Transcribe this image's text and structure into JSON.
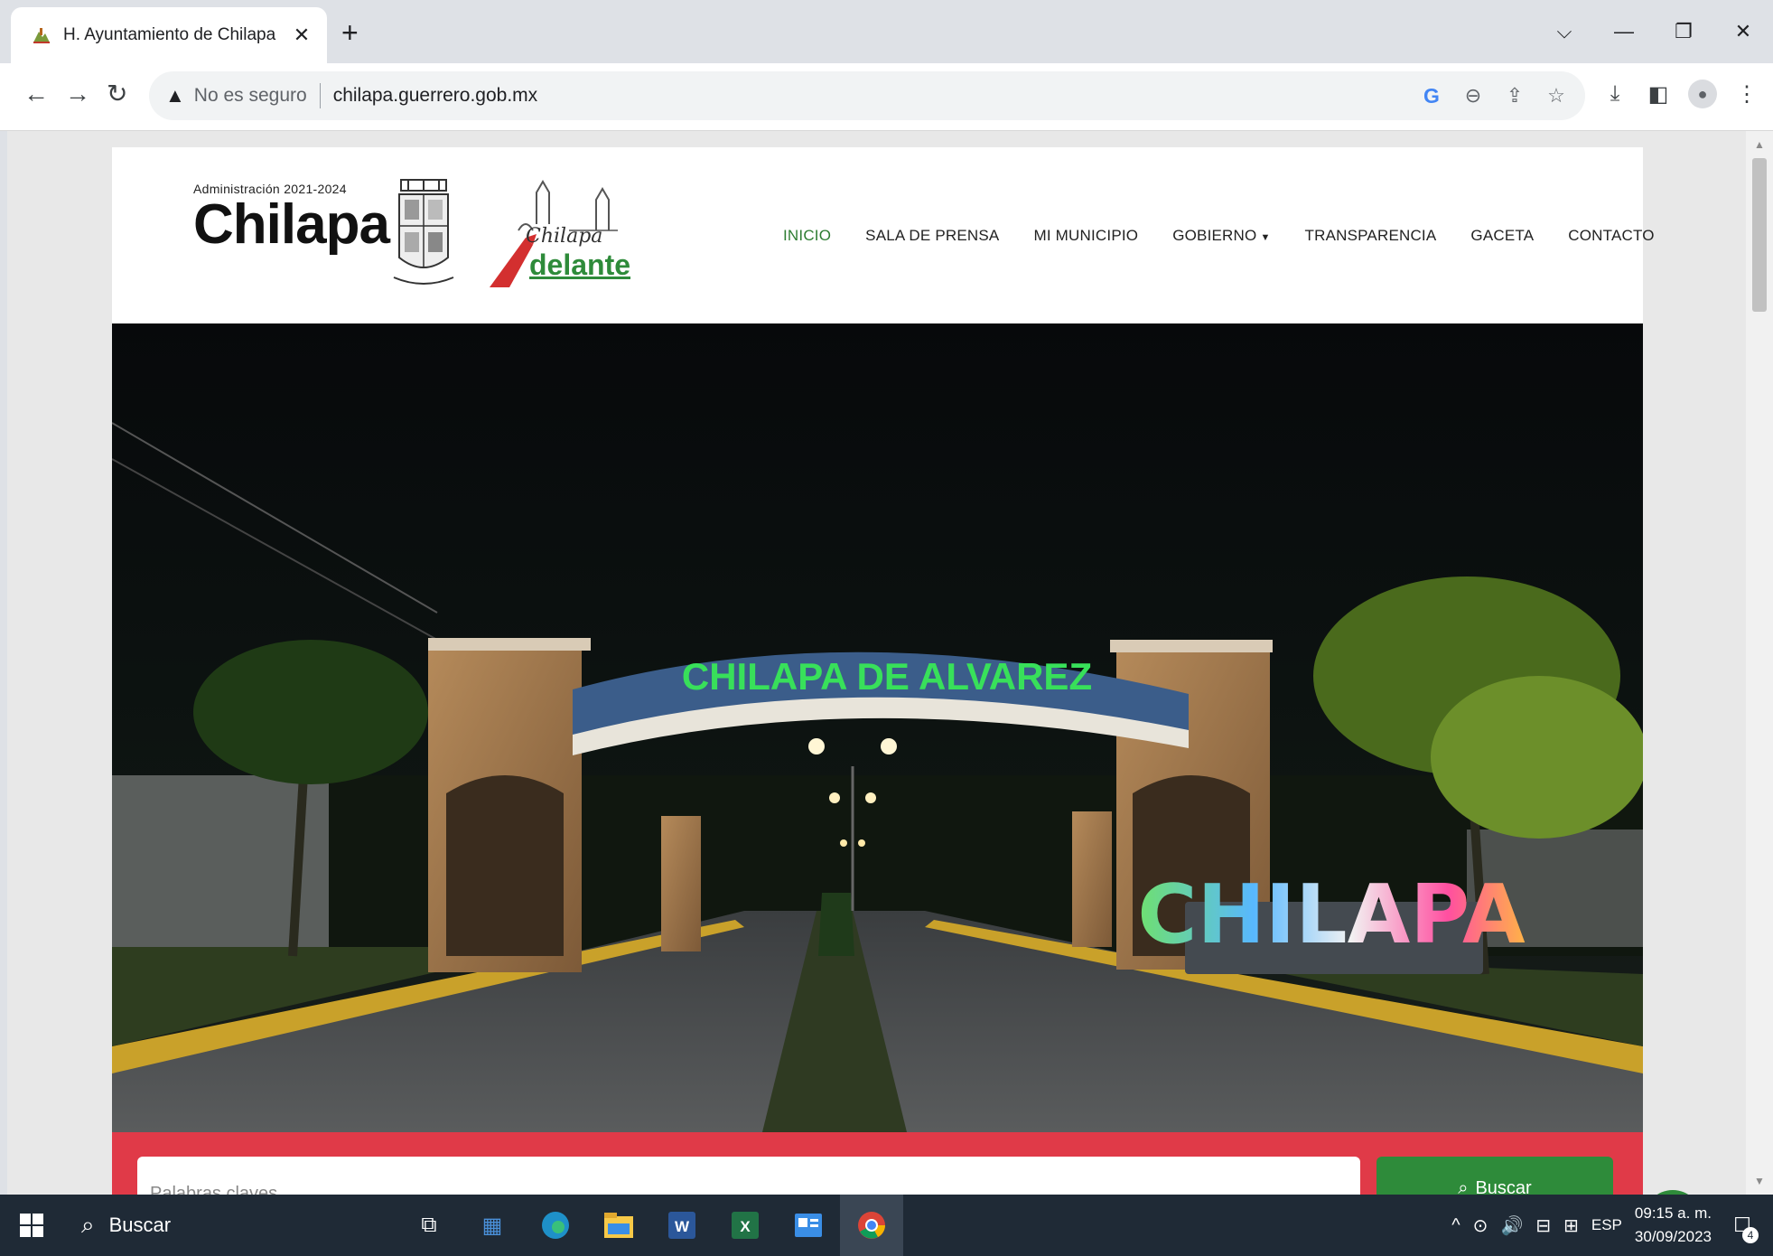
{
  "browser": {
    "tab_title": "H. Ayuntamiento de Chilapa de",
    "tab_close": "✕",
    "new_tab": "+",
    "security_label": "No es seguro",
    "url": "chilapa.guerrero.gob.mx"
  },
  "site": {
    "admin_line": "Administración 2021-2024",
    "logo_word": "Chilapa",
    "adelante_script": "Chilapa",
    "adelante_word": "delante",
    "nav": [
      {
        "label": "INICIO",
        "active": true
      },
      {
        "label": "SALA DE PRENSA"
      },
      {
        "label": "MI MUNICIPIO"
      },
      {
        "label": "GOBIERNO"
      },
      {
        "label": "TRANSPARENCIA"
      },
      {
        "label": "GACETA"
      },
      {
        "label": "CONTACTO"
      }
    ],
    "hero": {
      "arch_sign": "CHILAPA DE ALVAREZ",
      "letters_sign": "CHILAPA"
    },
    "search": {
      "placeholder": "Palabras claves",
      "button_label": "Buscar"
    },
    "accent_green": "#2e8b3a",
    "accent_red": "#e03a48"
  },
  "taskbar": {
    "search_label": "Buscar",
    "language": "ESP",
    "time": "09:15 a. m.",
    "date": "30/09/2023",
    "notifications": "4"
  }
}
